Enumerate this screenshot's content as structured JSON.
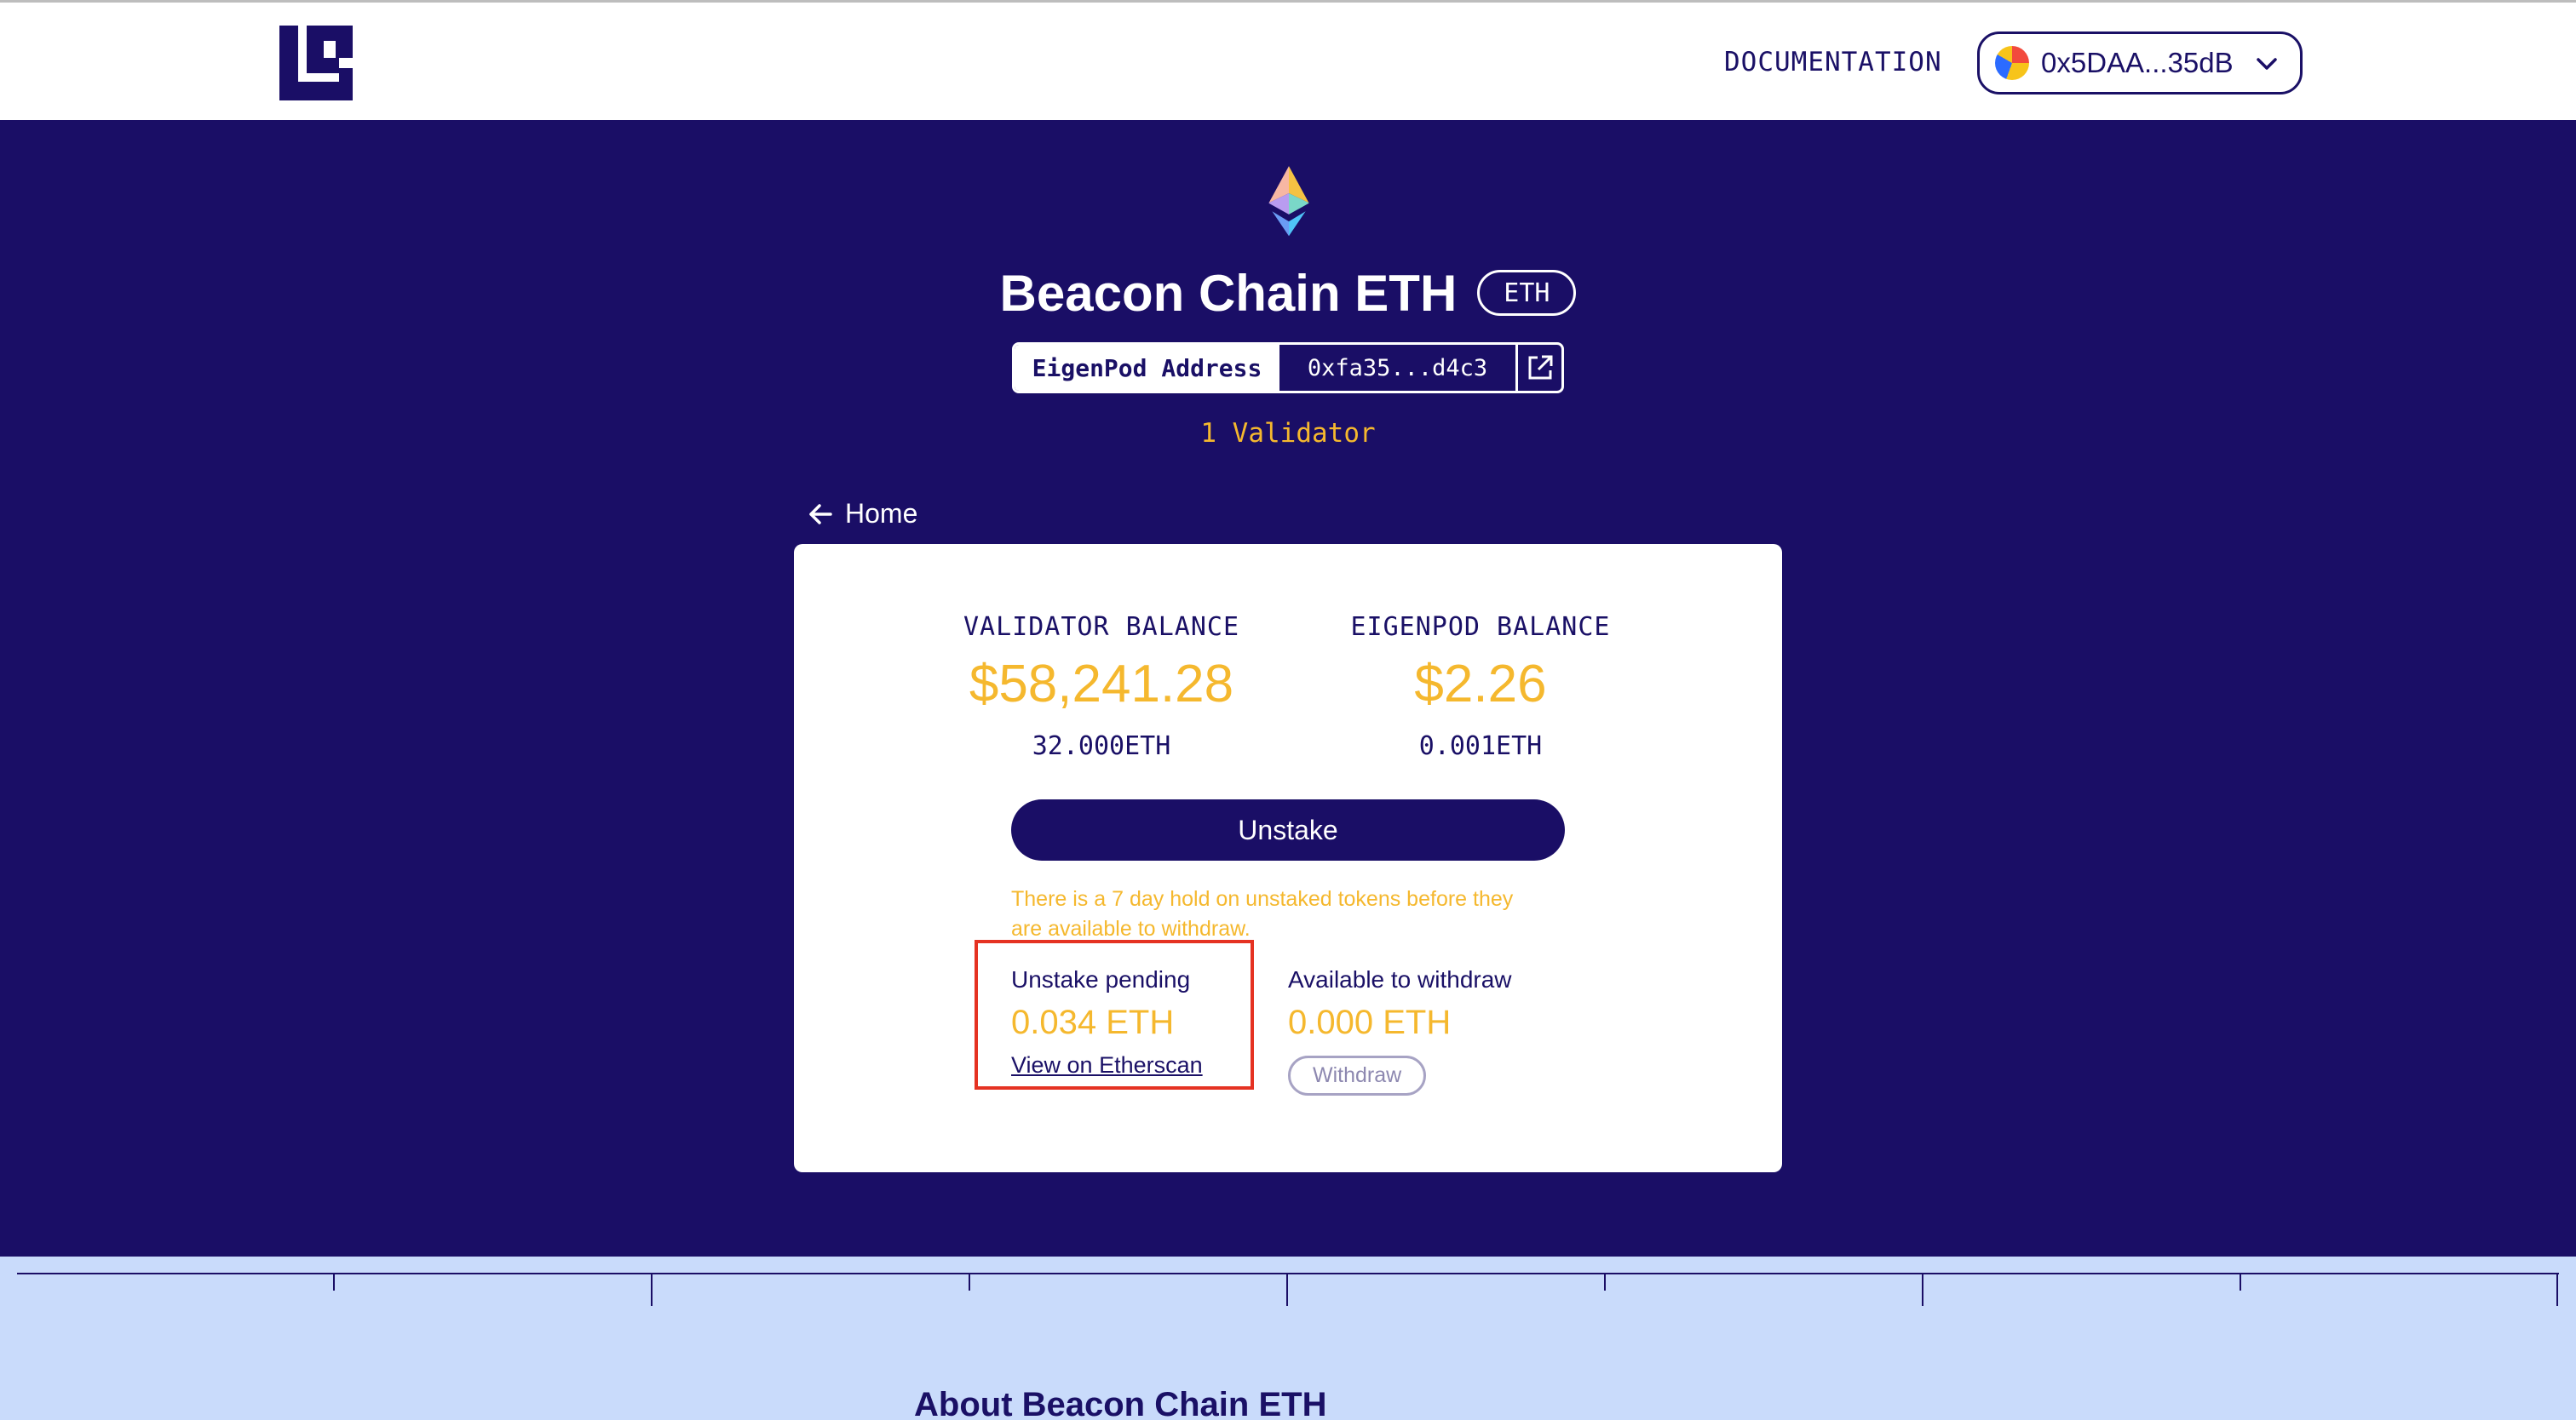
{
  "header": {
    "documentation_label": "DOCUMENTATION",
    "wallet_address": "0x5DAA...35dB"
  },
  "token": {
    "name": "Beacon Chain ETH",
    "symbol": "ETH",
    "eigenpod_label": "EigenPod Address",
    "eigenpod_address": "0xfa35...d4c3",
    "validator_count": "1 Validator"
  },
  "nav": {
    "home_label": "Home"
  },
  "balances": {
    "validator": {
      "label": "VALIDATOR BALANCE",
      "usd": "$58,241.28",
      "eth": "32.000ETH"
    },
    "eigenpod": {
      "label": "EIGENPOD BALANCE",
      "usd": "$2.26",
      "eth": "0.001ETH"
    }
  },
  "actions": {
    "unstake_label": "Unstake",
    "hold_note": "There is a 7 day hold on unstaked tokens before they are available to withdraw.",
    "withdraw_label": "Withdraw"
  },
  "pending": {
    "label": "Unstake pending",
    "value": "0.034 ETH",
    "link_label": "View on Etherscan"
  },
  "available": {
    "label": "Available to withdraw",
    "value": "0.000 ETH"
  },
  "about": {
    "title": "About Beacon Chain ETH"
  },
  "colors": {
    "navy": "#1a0e66",
    "accent": "#f5b82e",
    "highlight": "#e53222",
    "about_bg": "#c9dbfb"
  }
}
